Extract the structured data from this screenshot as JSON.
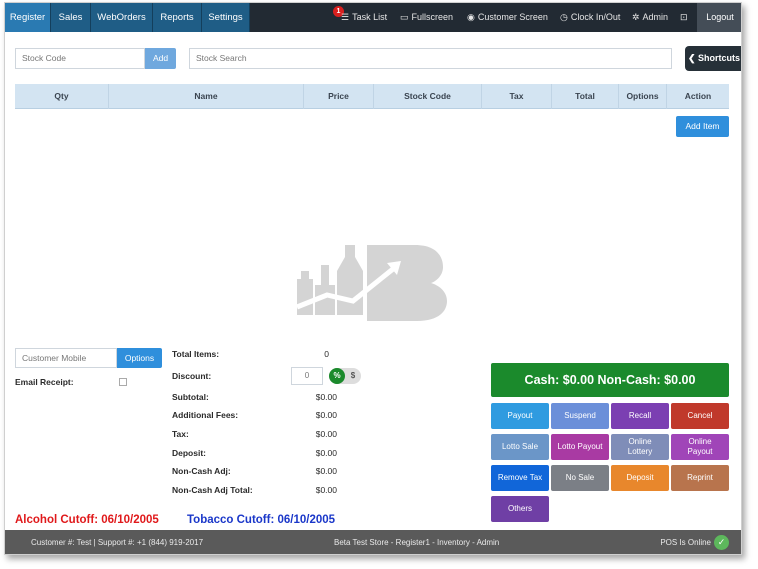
{
  "nav": {
    "tabs": [
      "Register",
      "Sales",
      "WebOrders",
      "Reports",
      "Settings"
    ],
    "task_badge": "1",
    "task_list": "Task List",
    "fullscreen": "Fullscreen",
    "customer_screen": "Customer Screen",
    "clock": "Clock In/Out",
    "admin": "Admin",
    "logout": "Logout"
  },
  "search": {
    "stock_code_placeholder": "Stock Code",
    "add_label": "Add",
    "stock_search_placeholder": "Stock Search",
    "shortcuts_label": "Shortcuts"
  },
  "table": {
    "columns": [
      "Qty",
      "Name",
      "Price",
      "Stock Code",
      "Tax",
      "Total",
      "Options",
      "Action"
    ],
    "add_item_label": "Add Item"
  },
  "customer": {
    "mobile_placeholder": "Customer Mobile",
    "options_label": "Options",
    "email_receipt_label": "Email Receipt:"
  },
  "totals": {
    "total_items_label": "Total Items:",
    "total_items_value": "0",
    "discount_label": "Discount:",
    "discount_value": "0",
    "discount_pct": "%",
    "discount_dollar": "$",
    "subtotal_label": "Subtotal:",
    "subtotal_value": "$0.00",
    "fees_label": "Additional Fees:",
    "fees_value": "$0.00",
    "tax_label": "Tax:",
    "tax_value": "$0.00",
    "deposit_label": "Deposit:",
    "deposit_value": "$0.00",
    "noncash_label": "Non-Cash Adj:",
    "noncash_value": "$0.00",
    "noncash_total_label": "Non-Cash Adj Total:",
    "noncash_total_value": "$0.00"
  },
  "cutoff": {
    "alcohol": "Alcohol Cutoff: 06/10/2005",
    "tobacco": "Tobacco Cutoff: 06/10/2005",
    "alcohol_color": "#e0191b",
    "tobacco_color": "#1a37c9"
  },
  "payment": {
    "cash_summary": "Cash: $0.00  Non-Cash: $0.00",
    "actions": [
      {
        "label": "Payout",
        "color": "#2f9be0"
      },
      {
        "label": "Suspend",
        "color": "#6b8fd9"
      },
      {
        "label": "Recall",
        "color": "#7b3fb2"
      },
      {
        "label": "Cancel",
        "color": "#c0392b"
      },
      {
        "label": "Lotto Sale",
        "color": "#6b96c8"
      },
      {
        "label": "Lotto Payout",
        "color": "#a93aa3"
      },
      {
        "label": "Online Lottery",
        "color": "#7f8db8"
      },
      {
        "label": "Online Payout",
        "color": "#a045b8"
      },
      {
        "label": "Remove Tax",
        "color": "#1166d9"
      },
      {
        "label": "No Sale",
        "color": "#7b7f86"
      },
      {
        "label": "Deposit",
        "color": "#e8872c"
      },
      {
        "label": "Reprint",
        "color": "#b8744d"
      },
      {
        "label": "Others",
        "color": "#6f3fa5"
      }
    ]
  },
  "footer": {
    "left": "Customer #: Test | Support #: +1 (844) 919-2017",
    "center": "Beta Test Store - Register1 - Inventory - Admin",
    "status": "POS Is Online"
  }
}
